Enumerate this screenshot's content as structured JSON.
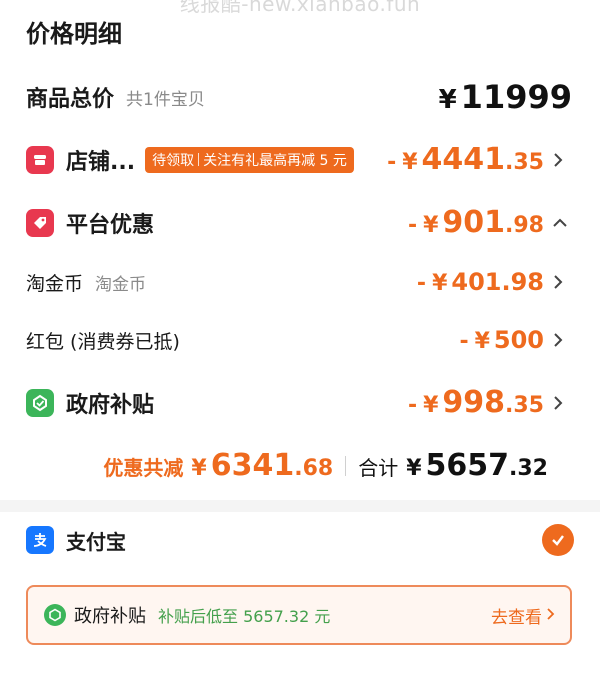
{
  "watermark": "线报酷-new.xianbao.fun",
  "section_title": "价格明细",
  "goods_total": {
    "label": "商品总价",
    "sub": "共1件宝贝",
    "currency": "¥",
    "amount": "11999"
  },
  "store": {
    "label": "店铺...",
    "badge_a": "待领取",
    "badge_b": "关注有礼最高再减 5 元",
    "sign": "-",
    "currency": "¥",
    "int": "4441",
    "dec": ".35"
  },
  "platform": {
    "label": "平台优惠",
    "sign": "-",
    "currency": "¥",
    "int": "901",
    "dec": ".98"
  },
  "taojinbi": {
    "label": "淘金币",
    "sub": "淘金币",
    "sign": "-",
    "currency": "¥",
    "int": "401.98"
  },
  "hongbao": {
    "label": "红包 (消费券已抵)",
    "sign": "-",
    "currency": "¥",
    "int": "500"
  },
  "gov": {
    "label": "政府补贴",
    "sign": "-",
    "currency": "¥",
    "int": "998",
    "dec": ".35"
  },
  "summary": {
    "discount_label": "优惠共减",
    "discount_currency": "¥",
    "discount_int": "6341",
    "discount_dec": ".68",
    "total_label": "合计",
    "total_currency": "¥",
    "total_int": "5657",
    "total_dec": ".32"
  },
  "payment": {
    "label": "支付宝"
  },
  "subsidy_box": {
    "label": "政府补贴",
    "note": "补贴后低至 5657.32 元",
    "link": "去查看"
  },
  "colors": {
    "accent": "#ee6a1e",
    "store_icon": "#e8384f",
    "platform_icon": "#e8384f",
    "gov_icon": "#3cb55a",
    "alipay": "#1677ff"
  }
}
